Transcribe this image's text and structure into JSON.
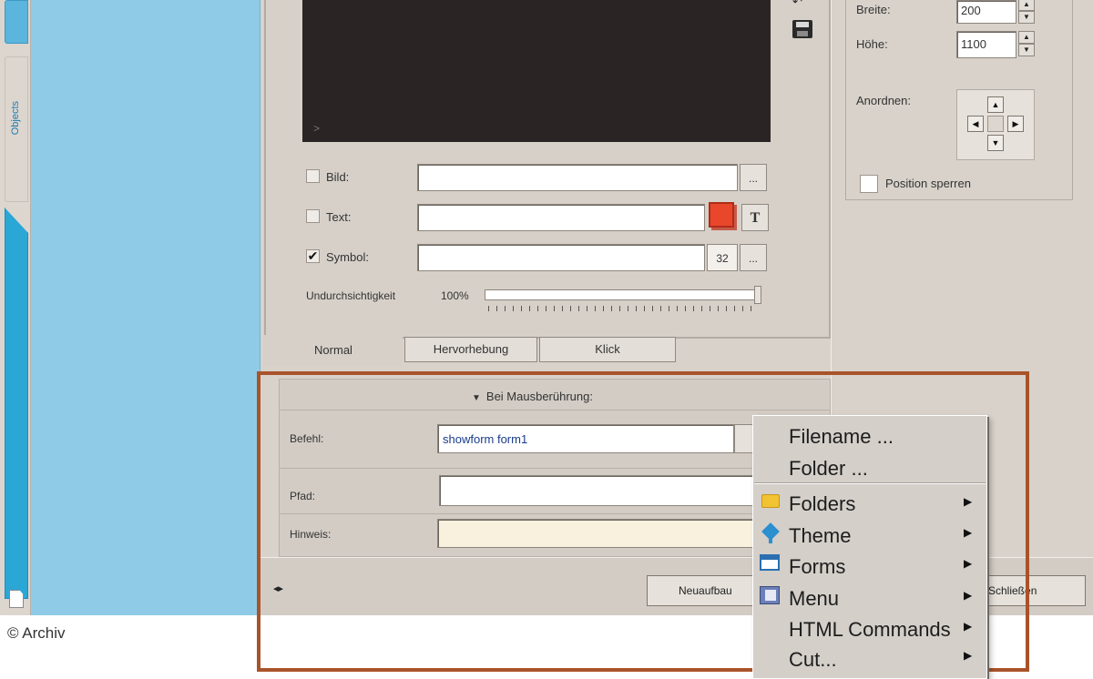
{
  "left_panel": {
    "tab_objects": "Objects"
  },
  "preview": {
    "arrow_icon": "play-arrow-icon"
  },
  "properties": {
    "bild_label": "Bild:",
    "bild_checked": false,
    "text_label": "Text:",
    "text_checked": false,
    "symbol_label": "Symbol:",
    "symbol_checked": true,
    "symbol_size": "32",
    "browse_label": "...",
    "font_button_label": "T",
    "text_color": "#e8472c",
    "opacity_label": "Undurchsichtigkeit",
    "opacity_value": "100%",
    "opacity_fraction": 1.0
  },
  "tabs": [
    {
      "label": "Normal",
      "selected": true
    },
    {
      "label": "Hervorhebung",
      "selected": false
    },
    {
      "label": "Klick",
      "selected": false
    }
  ],
  "size": {
    "breite_label": "Breite:",
    "breite_value": "200",
    "hoehe_label": "Höhe:",
    "hoehe_value": "1100",
    "anordnen_label": "Anordnen:",
    "lock_label": "Position sperren",
    "lock_checked": false
  },
  "event": {
    "header": "Bei Mausberührung:",
    "befehl_label": "Befehl:",
    "befehl_value": "showform form1",
    "pfad_label": "Pfad:",
    "pfad_value": "",
    "hinweis_label": "Hinweis:",
    "hinweis_value": ""
  },
  "buttons": {
    "neuaufbau": "Neuaufbau",
    "schliessen": "Schließen"
  },
  "context_menu": {
    "items": [
      {
        "label": "Filename ...",
        "submenu": false
      },
      {
        "label": "Folder ...",
        "submenu": false
      },
      {
        "label": "Folders",
        "icon": "folder-icon",
        "submenu": true
      },
      {
        "label": "Theme",
        "icon": "theme-icon",
        "submenu": true
      },
      {
        "label": "Forms",
        "icon": "forms-icon",
        "submenu": true
      },
      {
        "label": "Menu",
        "icon": "menu-icon",
        "submenu": true
      },
      {
        "label": "HTML Commands",
        "submenu": true
      },
      {
        "label": "Cut...",
        "submenu": true
      }
    ]
  },
  "credit": "© Archiv",
  "colors": {
    "highlight_frame": "#a9532a",
    "left_panel": "#8fcbe6",
    "dialog": "#d8d2cb"
  }
}
